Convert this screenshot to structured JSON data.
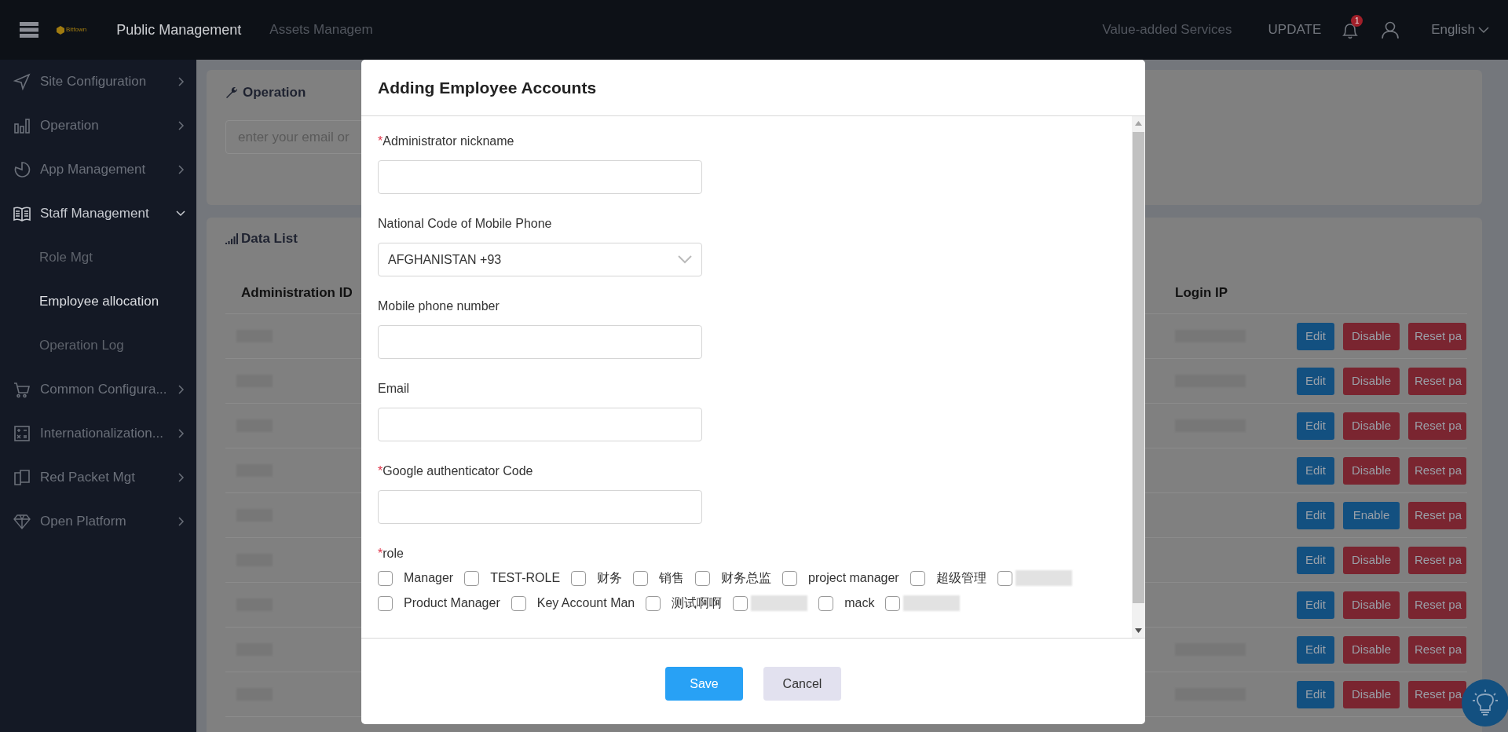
{
  "topbar": {
    "brand": "Bitfown",
    "title": "Public Management",
    "nav": [
      {
        "label": "Assets Managem"
      },
      {
        "label": "Value-added Services"
      }
    ],
    "update": "UPDATE",
    "notifications": "1",
    "language": "English"
  },
  "sidebar": {
    "items": [
      {
        "label": "Site Configuration",
        "expanded": false
      },
      {
        "label": "Operation",
        "expanded": false
      },
      {
        "label": "App Management",
        "expanded": false
      },
      {
        "label": "Staff Management",
        "expanded": true,
        "children": [
          {
            "label": "Role Mgt",
            "selected": false
          },
          {
            "label": "Employee allocation",
            "selected": true
          },
          {
            "label": "Operation Log",
            "selected": false
          }
        ]
      },
      {
        "label": "Common Configura...",
        "expanded": false
      },
      {
        "label": "Internationalization...",
        "expanded": false
      },
      {
        "label": "Red Packet Mgt",
        "expanded": false
      },
      {
        "label": "Open Platform",
        "expanded": false
      }
    ]
  },
  "operation_card": {
    "title": "Operation",
    "search": {
      "placeholder": "enter your email or"
    }
  },
  "data_list": {
    "title": "Data List",
    "columns": [
      "Administration ID",
      "Login IP"
    ],
    "rows": [
      {
        "ip_redacted": true,
        "buttons": [
          {
            "label": "Edit",
            "kind": "edit"
          },
          {
            "label": "Disable",
            "kind": "disable"
          },
          {
            "label": "Reset pa",
            "kind": "reset"
          }
        ]
      },
      {
        "ip_redacted": true,
        "buttons": [
          {
            "label": "Edit",
            "kind": "edit"
          },
          {
            "label": "Disable",
            "kind": "disable"
          },
          {
            "label": "Reset pa",
            "kind": "reset"
          }
        ]
      },
      {
        "ip_redacted": true,
        "buttons": [
          {
            "label": "Edit",
            "kind": "edit"
          },
          {
            "label": "Disable",
            "kind": "disable"
          },
          {
            "label": "Reset pa",
            "kind": "reset"
          }
        ]
      },
      {
        "ip_redacted": false,
        "buttons": [
          {
            "label": "Edit",
            "kind": "edit"
          },
          {
            "label": "Disable",
            "kind": "disable"
          },
          {
            "label": "Reset pa",
            "kind": "reset"
          }
        ]
      },
      {
        "ip_redacted": false,
        "buttons": [
          {
            "label": "Edit",
            "kind": "edit"
          },
          {
            "label": "Enable",
            "kind": "enable"
          },
          {
            "label": "Reset pa",
            "kind": "reset"
          }
        ]
      },
      {
        "ip_redacted": false,
        "buttons": [
          {
            "label": "Edit",
            "kind": "edit"
          },
          {
            "label": "Disable",
            "kind": "disable"
          },
          {
            "label": "Reset pa",
            "kind": "reset"
          }
        ]
      },
      {
        "ip_redacted": false,
        "buttons": [
          {
            "label": "Edit",
            "kind": "edit"
          },
          {
            "label": "Disable",
            "kind": "disable"
          },
          {
            "label": "Reset pa",
            "kind": "reset"
          }
        ]
      },
      {
        "ip_redacted": true,
        "buttons": [
          {
            "label": "Edit",
            "kind": "edit"
          },
          {
            "label": "Disable",
            "kind": "disable"
          },
          {
            "label": "Reset pa",
            "kind": "reset"
          }
        ]
      },
      {
        "ip_redacted": true,
        "buttons": [
          {
            "label": "Edit",
            "kind": "edit"
          },
          {
            "label": "Disable",
            "kind": "disable"
          },
          {
            "label": "Reset pa",
            "kind": "reset"
          }
        ]
      }
    ]
  },
  "modal": {
    "title": "Adding Employee Accounts",
    "fields": [
      {
        "label": "Administrator nickname",
        "required_mark": "*",
        "kind": "text"
      },
      {
        "label": "National Code of Mobile Phone",
        "kind": "select",
        "value": "AFGHANISTAN +93"
      },
      {
        "label": "Mobile phone number",
        "kind": "text"
      },
      {
        "label": "Email",
        "kind": "text"
      },
      {
        "label": "Google authenticator Code",
        "required_mark": "*",
        "kind": "text"
      }
    ],
    "role": {
      "label": "role",
      "required_mark": "*",
      "options": [
        {
          "kind": "named",
          "label": "Manager",
          "checked": false
        },
        {
          "kind": "named",
          "label": "TEST-ROLE",
          "checked": false
        },
        {
          "kind": "named",
          "label": "财务",
          "checked": false
        },
        {
          "kind": "named",
          "label": "销售",
          "checked": false
        },
        {
          "kind": "named",
          "label": "财务总监",
          "checked": false
        },
        {
          "kind": "named",
          "label": "project manager",
          "checked": false
        },
        {
          "kind": "named",
          "label": "超级管理",
          "checked": false
        },
        {
          "kind": "redacted",
          "checked": false
        },
        {
          "kind": "named",
          "label": "Product Manager",
          "checked": false
        },
        {
          "kind": "named",
          "label": "Key Account Man",
          "checked": false
        },
        {
          "kind": "named",
          "label": "测试啊啊",
          "checked": false
        },
        {
          "kind": "redacted",
          "checked": false
        },
        {
          "kind": "named",
          "label": "mack",
          "checked": false
        },
        {
          "kind": "redacted",
          "checked": false
        }
      ]
    },
    "buttons": [
      {
        "label": "Save",
        "kind": "primary"
      },
      {
        "label": "Cancel",
        "kind": "secondary"
      }
    ]
  }
}
